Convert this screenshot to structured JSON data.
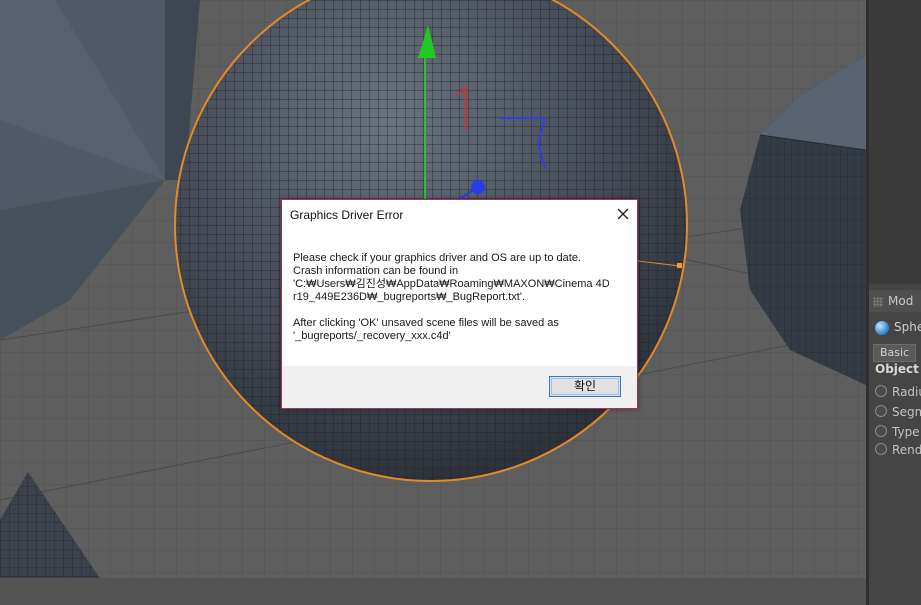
{
  "right_panel": {
    "attr_header": "Mod",
    "object_name": "Sphe",
    "tabs": [
      "Basic"
    ],
    "section_title": "Object P",
    "properties": [
      "Radiu",
      "Segm",
      "Type",
      "Rende"
    ]
  },
  "dialog": {
    "title": "Graphics Driver Error",
    "message_lines": [
      "Please check if your graphics driver and OS are up to date.",
      "Crash information can be found in",
      "'C:₩Users₩김진성₩AppData₩Roaming₩MAXON₩Cinema 4D",
      "r19_449E236D₩_bugreports₩_BugReport.txt'."
    ],
    "note_lines": [
      "After clicking 'OK' unsaved scene files will be saved as",
      "'_bugreports/_recovery_xxx.c4d'"
    ],
    "ok_label": "확인"
  },
  "colors": {
    "selection_outline": "#e08a2a",
    "dialog_border": "#b02a62",
    "axis_y": "#22c922",
    "axis_x": "#c83232",
    "axis_z": "#3040e0"
  }
}
